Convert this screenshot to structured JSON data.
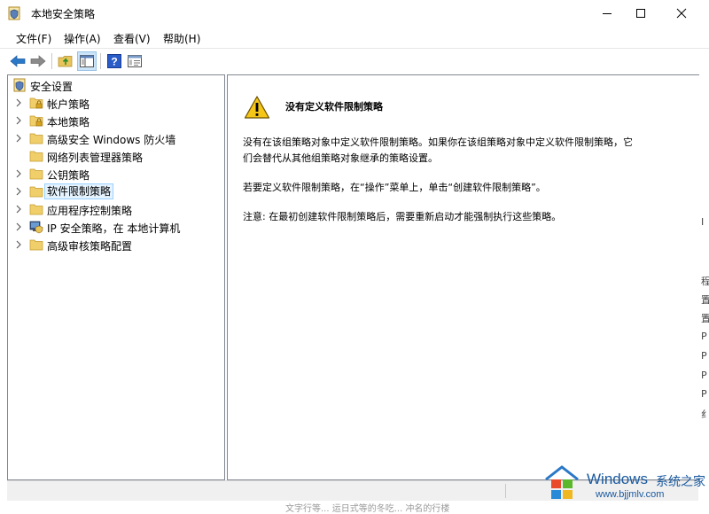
{
  "window": {
    "title": "本地安全策略",
    "controls": {
      "minimize": "–",
      "maximize": "☐",
      "close": "✕"
    }
  },
  "menu": [
    {
      "label": "文件(F)"
    },
    {
      "label": "操作(A)"
    },
    {
      "label": "查看(V)"
    },
    {
      "label": "帮助(H)"
    }
  ],
  "toolbar": {
    "buttons": [
      "back-icon",
      "forward-icon",
      "up-folder-icon",
      "show-hide-tree-icon",
      "help-icon",
      "properties-icon"
    ]
  },
  "tree": {
    "root": {
      "label": "安全设置",
      "icon": "security-settings-icon"
    },
    "items": [
      {
        "label": "帐户策略",
        "icon": "locked-folder-icon"
      },
      {
        "label": "本地策略",
        "icon": "locked-folder-icon"
      },
      {
        "label": "高级安全 Windows 防火墙",
        "icon": "folder-icon"
      },
      {
        "label": "网络列表管理器策略",
        "icon": "folder-icon"
      },
      {
        "label": "公钥策略",
        "icon": "folder-icon"
      },
      {
        "label": "软件限制策略",
        "icon": "folder-icon",
        "selected": true
      },
      {
        "label": "应用程序控制策略",
        "icon": "folder-icon"
      },
      {
        "label": "IP 安全策略，在 本地计算机",
        "icon": "ip-security-icon"
      },
      {
        "label": "高级审核策略配置",
        "icon": "folder-icon"
      }
    ]
  },
  "detail": {
    "title": "没有定义软件限制策略",
    "para1_line1": "没有在该组策略对象中定义软件限制策略。如果你在该组策略对象中定义软件限制策略，它",
    "para1_line2": "们会替代从其他组策略对象继承的策略设置。",
    "para2": "若要定义软件限制策略，在“操作”菜单上，单击“创建软件限制策略”。",
    "para3": "注意: 在最初创建软件限制策略后，需要重新启动才能强制执行这些策略。"
  },
  "background_strip": [
    "I",
    "程",
    "置",
    "置",
    "P",
    "P",
    "P",
    "P",
    "纟"
  ],
  "bottom_text": "文字行等... 运日式等的冬吃... 冲名的行楼",
  "watermark": {
    "brand": "Windows",
    "sub": "系统之家",
    "url": "www.bjjmlv.com"
  },
  "colors": {
    "selection_bg": "#e5f3ff",
    "selection_border": "#99d1ff",
    "pane_border": "#828790",
    "watermark_blue": "#1a5aa0"
  }
}
